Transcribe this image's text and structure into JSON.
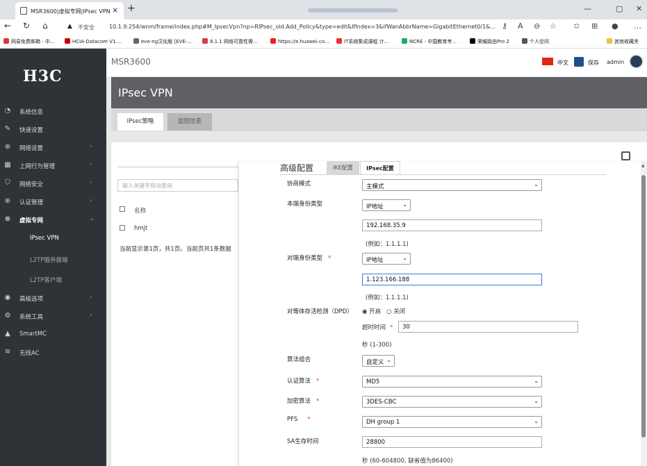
{
  "browser": {
    "tab_title": "MSR3600|虚拟专网|IPsec VPN",
    "new_tab": "+",
    "tab_close": "×",
    "url_insecure": "不安全",
    "url": "10.1.9.254/wnm/frame/index.php#M_IpsecVpn?np=RIPsec_old.Add_Policy&type=edit&IfIndex=3&ifWanAbbrName=GigabitEthernet0/1&...",
    "bookmarks": [
      "网易免费邮箱 - 中...",
      "HCIA-Datacom V1....",
      "eve-ng汉化版 [EVE-...",
      "8.1.1 网络可靠性需...",
      "https://e.huawei.co...",
      "IT系统集成课程 计...",
      "NCRE - 中国教育考...",
      "荣耀路由Pro 2",
      "个人空间",
      "其他收藏夹"
    ],
    "bookmark_colors": [
      "#d33",
      "#c00",
      "#666",
      "#c44",
      "#e22",
      "#e33",
      "#2a6",
      "#000",
      "#555",
      "#f0c040"
    ]
  },
  "app": {
    "logo": "H3C",
    "device": "MSR3600",
    "lang": "中文",
    "save": "保存",
    "user": "admin"
  },
  "sidebar": {
    "items": [
      {
        "label": "系统信息",
        "icon": "gauge-icon",
        "glyph": "◔",
        "chevron": ""
      },
      {
        "label": "快速设置",
        "icon": "wizard-icon",
        "glyph": "✎",
        "chevron": ""
      },
      {
        "label": "网络设置",
        "icon": "globe-icon",
        "glyph": "⊕",
        "chevron": "›"
      },
      {
        "label": "上网行为管理",
        "icon": "grid-icon",
        "glyph": "▦",
        "chevron": "›"
      },
      {
        "label": "网络安全",
        "icon": "shield-icon",
        "glyph": "⛉",
        "chevron": "›"
      },
      {
        "label": "认证管理",
        "icon": "globe-icon",
        "glyph": "⊕",
        "chevron": "›"
      },
      {
        "label": "虚拟专网",
        "icon": "vpn-icon",
        "glyph": "⊗",
        "chevron": "⌄"
      },
      {
        "label": "高级选项",
        "icon": "settings-icon",
        "glyph": "◉",
        "chevron": "›"
      },
      {
        "label": "系统工具",
        "icon": "tools-icon",
        "glyph": "⚙",
        "chevron": "›"
      },
      {
        "label": "SmartMC",
        "icon": "smartmc-icon",
        "glyph": "▲",
        "chevron": ""
      },
      {
        "label": "无线AC",
        "icon": "wifi-icon",
        "glyph": "≋",
        "chevron": ""
      }
    ],
    "sub_items": [
      "IPsec VPN",
      "L2TP服务器端",
      "L2TP客户端"
    ]
  },
  "page": {
    "title": "IPsec VPN",
    "tabs": [
      "IPsec策略",
      "监控信息"
    ]
  },
  "list": {
    "search_placeholder": "输入关键字目动查询",
    "col_name": "名称",
    "rows": [
      "hmjt"
    ],
    "pager": "当前显示第1页，共1页。当前页共1条数据"
  },
  "panel": {
    "title": "高级配置",
    "tabs": [
      "IKE配置",
      "IPsec配置"
    ],
    "negotiation_mode": {
      "label": "协商模式",
      "value": "主模式"
    },
    "local_id_type": {
      "label": "本端身份类型",
      "value": "IP地址",
      "ip": "192.168.35.9",
      "hint": "(例如：1.1.1.1)"
    },
    "remote_id_type": {
      "label": "对端身份类型",
      "value": "IP地址",
      "ip": "1.123.166.188",
      "hint": "(例如：1.1.1.1)"
    },
    "dpd": {
      "label": "对等体存活检测（DPD）",
      "on": "开启",
      "off": "关闭",
      "timeout_label": "超时时间",
      "timeout": "30",
      "timeout_hint": "秒 (1-300)"
    },
    "algorithm_suite": {
      "label": "算法组合",
      "value": "自定义"
    },
    "auth_algorithm": {
      "label": "认证算法",
      "value": "MD5"
    },
    "encryption_algorithm": {
      "label": "加密算法",
      "value": "3DES-CBC"
    },
    "pfs": {
      "label": "PFS",
      "value": "DH group 1"
    },
    "sa_lifetime": {
      "label": "SA生存时间",
      "value": "28800",
      "hint": "秒 (60-604800, 缺省值为86400)"
    },
    "required_mark": "*"
  }
}
